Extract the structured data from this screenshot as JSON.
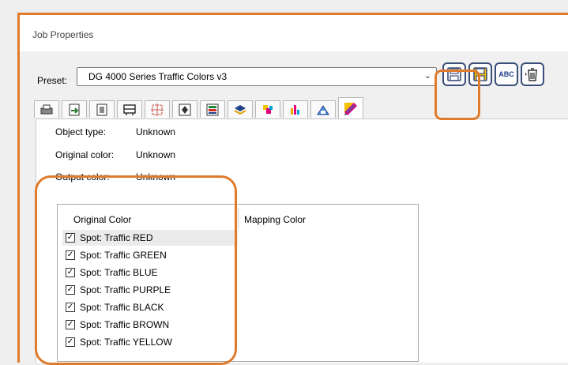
{
  "window": {
    "title": "Job Properties"
  },
  "preset": {
    "label": "Preset:",
    "value": "DG 4000 Series Traffic Colors v3"
  },
  "toolbar": {
    "buttons": [
      {
        "name": "save-preset-button",
        "icon": "floppy-disk-icon",
        "color": "#3b4e7a"
      },
      {
        "name": "save-as-preset-button",
        "icon": "floppy-disk-icon",
        "color": "#d9a400"
      },
      {
        "name": "rename-preset-button",
        "icon": "abc-icon",
        "text": "ABC"
      },
      {
        "name": "delete-preset-button",
        "icon": "trash-icon"
      }
    ]
  },
  "tabs": [
    {
      "name": "tab-printer",
      "icon": "printer-icon",
      "color": "#555555"
    },
    {
      "name": "tab-layout",
      "icon": "page-arrow-icon",
      "color": "#2e7d32"
    },
    {
      "name": "tab-image",
      "icon": "image-icon",
      "color": "#444444"
    },
    {
      "name": "tab-media",
      "icon": "media-icon",
      "color": "#444444"
    },
    {
      "name": "tab-marks",
      "icon": "crop-marks-icon",
      "color": "#c0392b"
    },
    {
      "name": "tab-transform",
      "icon": "transform-icon",
      "color": "#333333"
    },
    {
      "name": "tab-color",
      "icon": "color-bars-icon",
      "color": "#1b8a3a"
    },
    {
      "name": "tab-profile",
      "icon": "layers-icon",
      "color": "#1f3f8a"
    },
    {
      "name": "tab-spot",
      "icon": "spot-color-icon",
      "color": "#e0007a"
    },
    {
      "name": "tab-channels",
      "icon": "channels-icon",
      "color": "#f2a100"
    },
    {
      "name": "tab-print-mode",
      "icon": "print-mode-icon",
      "color": "#1f5fa6"
    },
    {
      "name": "tab-color-mapping",
      "icon": "color-pen-icon",
      "color": "#7b3fa0",
      "active": true
    }
  ],
  "info": {
    "object_type_label": "Object type:",
    "object_type_value": "Unknown",
    "original_color_label": "Original color:",
    "original_color_value": "Unknown",
    "output_color_label": "Output color:",
    "output_color_value": "Unknown"
  },
  "list": {
    "columns": [
      "Original Color",
      "Mapping Color"
    ],
    "rows": [
      {
        "label": "Spot: Traffic RED",
        "checked": true
      },
      {
        "label": "Spot: Traffic GREEN",
        "checked": true
      },
      {
        "label": "Spot: Traffic BLUE",
        "checked": true
      },
      {
        "label": "Spot: Traffic PURPLE",
        "checked": true
      },
      {
        "label": "Spot: Traffic BLACK",
        "checked": true
      },
      {
        "label": "Spot: Traffic BROWN",
        "checked": true
      },
      {
        "label": "Spot: Traffic YELLOW",
        "checked": true
      }
    ]
  },
  "highlight_color": "#e07b2c"
}
